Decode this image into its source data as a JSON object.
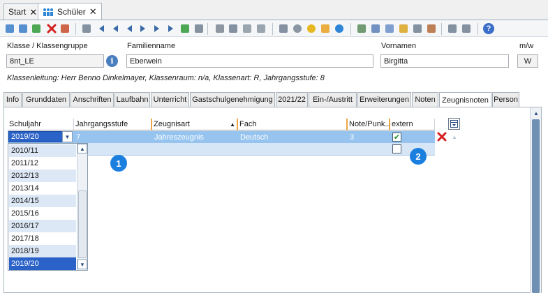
{
  "doc_tabs": [
    {
      "label": "Start"
    },
    {
      "label": "Schüler"
    }
  ],
  "toolbar_icons": [
    "new-icon",
    "save-icon",
    "undo-icon",
    "delete-icon",
    "close-record-icon",
    "copy-icon",
    "first-icon",
    "prev-page-icon",
    "prev-icon",
    "next-icon",
    "next-page-icon",
    "last-icon",
    "refresh-icon",
    "list-icon",
    "arrow-left-icon",
    "cut-icon",
    "copy-doc-icon",
    "paste-icon",
    "print-icon",
    "disc-icon",
    "bulb-icon",
    "bell-icon",
    "clock-icon",
    "grid-settings-icon",
    "user-settings-icon",
    "export-icon",
    "folder-icon",
    "stop-icon",
    "id-card-icon",
    "eraser-icon",
    "eraser2-icon",
    "help-icon"
  ],
  "form": {
    "klasse_label": "Klasse / Klassengruppe",
    "klasse_value": "8nt_LE",
    "familienname_label": "Familienname",
    "familienname_value": "Eberwein",
    "vornamen_label": "Vornamen",
    "vornamen_value": "Birgitta",
    "mw_label": "m/w",
    "mw_value": "W",
    "info_line": "Klassenleitung: Herr Benno Dinkelmayer, Klassenraum: n/a, Klassenart: R, Jahrgangsstufe: 8"
  },
  "section_tabs": [
    "Info",
    "Grunddaten",
    "Anschriften",
    "Laufbahn",
    "Unterricht",
    "Gastschulgenehmigung",
    "2021/22",
    "Ein-/Austritt",
    "Erweiterungen",
    "Noten",
    "Zeugnisnoten",
    "Person"
  ],
  "grid": {
    "headers": [
      "Schuljahr",
      "Jahrgangsstufe",
      "Zeugnisart",
      "Fach",
      "Note/Punk...",
      "extern"
    ],
    "row1": {
      "schuljahr": "2019/20",
      "jahrgangsstufe": "7",
      "zeugnisart": "Jahreszeugnis",
      "fach": "Deutsch",
      "note": "3",
      "extern": true
    }
  },
  "dropdown": {
    "options": [
      "2010/11",
      "2011/12",
      "2012/13",
      "2013/14",
      "2014/15",
      "2015/16",
      "2016/17",
      "2017/18",
      "2018/19",
      "2019/20"
    ],
    "selected": "2019/20"
  },
  "badges": [
    "1",
    "2"
  ],
  "colors": {
    "selection": "#2a62c8",
    "row_highlight": "#96c4ef",
    "badge": "#1b7fe0",
    "delete_red": "#d42020"
  }
}
